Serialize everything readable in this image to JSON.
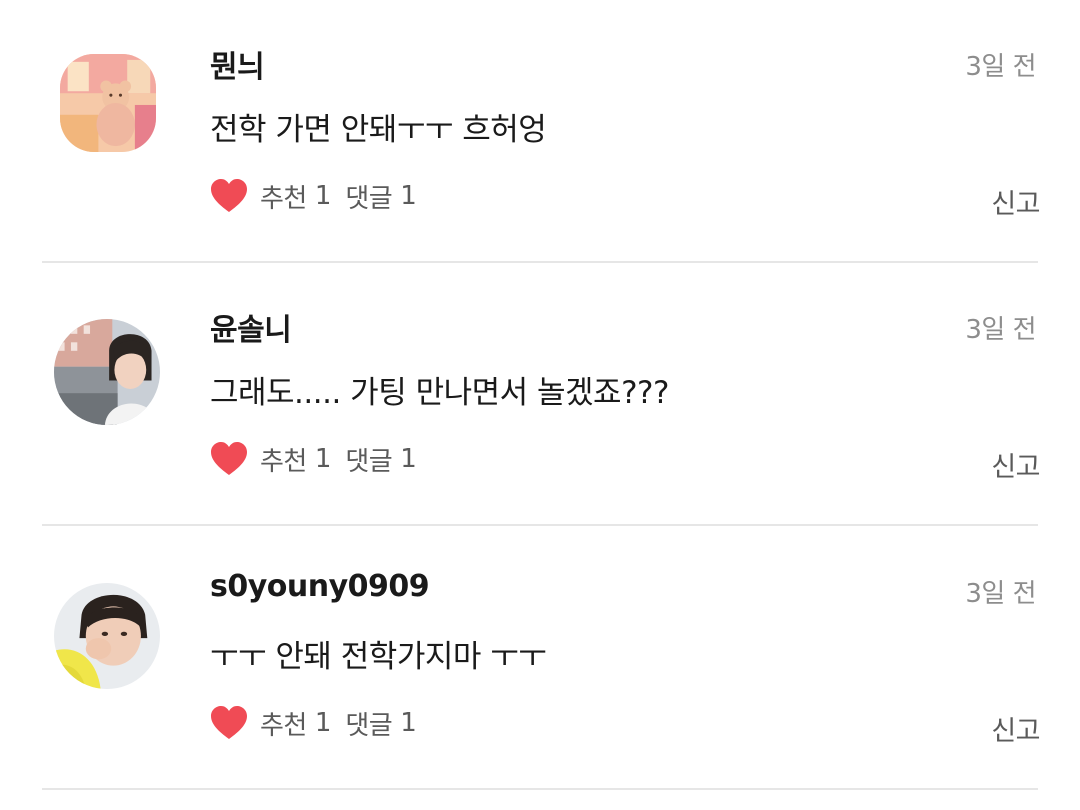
{
  "comments": [
    {
      "nickname": "뭔늬",
      "time": "3일 전",
      "text": "전학 가면 안돼ㅜㅜ 흐허엉",
      "recommend_label": "추천",
      "recommend_count": "1",
      "reply_label": "댓글",
      "reply_count": "1",
      "report_label": "신고",
      "avatar": "avatar-pink-room-teddy-bear"
    },
    {
      "nickname": "윤솔니",
      "time": "3일 전",
      "text": "그래도..... 가팅 만나면서 놀겠죠???",
      "recommend_label": "추천",
      "recommend_count": "1",
      "reply_label": "댓글",
      "reply_count": "1",
      "report_label": "신고",
      "avatar": "avatar-person-street"
    },
    {
      "nickname": "s0youny0909",
      "time": "3일 전",
      "text": "ㅜㅜ 안돼 전학가지마 ㅜㅜ",
      "recommend_label": "추천",
      "recommend_count": "1",
      "reply_label": "댓글",
      "reply_count": "1",
      "report_label": "신고",
      "avatar": "avatar-person-yellow-sleeve"
    }
  ],
  "colors": {
    "heart": "#f04b55",
    "text_primary": "#1a1a1a",
    "text_secondary": "#5a5a5a",
    "time": "#8d8d8d",
    "divider": "#e6e6e6"
  }
}
